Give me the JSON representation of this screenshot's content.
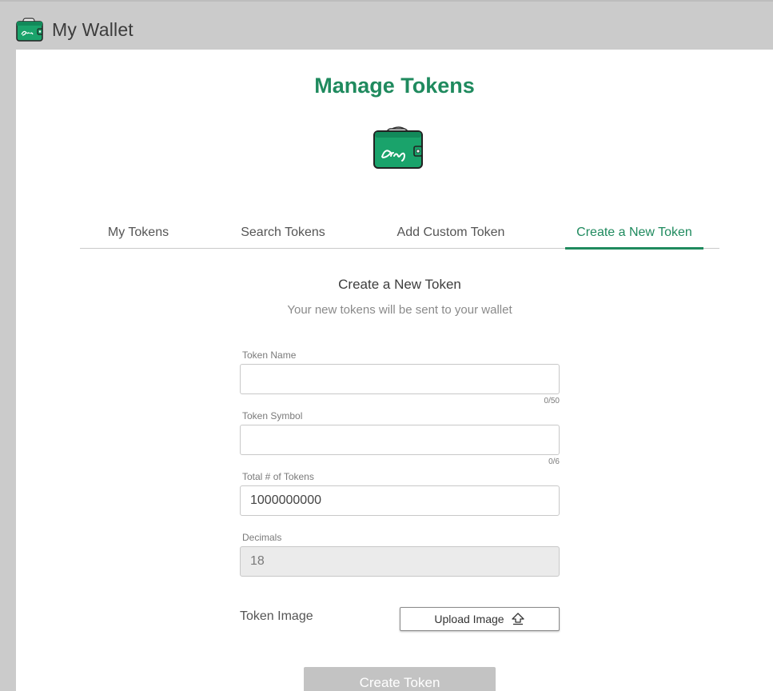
{
  "app": {
    "title": "My Wallet",
    "logo_icon": "wallet-logo-icon",
    "brand_color": "#1f8a5e"
  },
  "page": {
    "title": "Manage Tokens",
    "logo_icon": "wallet-logo-icon"
  },
  "tabs": [
    {
      "label": "My Tokens",
      "active": false
    },
    {
      "label": "Search Tokens",
      "active": false
    },
    {
      "label": "Add Custom Token",
      "active": false
    },
    {
      "label": "Create a New Token",
      "active": true
    }
  ],
  "form": {
    "title": "Create a New Token",
    "subtitle": "Your new tokens will be sent to your wallet",
    "token_name": {
      "label": "Token Name",
      "value": "",
      "counter": "0/50"
    },
    "token_symbol": {
      "label": "Token Symbol",
      "value": "",
      "counter": "0/6"
    },
    "total_tokens": {
      "label": "Total # of Tokens",
      "value": "1000000000"
    },
    "decimals": {
      "label": "Decimals",
      "value": "18"
    },
    "token_image": {
      "label": "Token Image",
      "upload_label": "Upload Image",
      "upload_icon": "upload-icon"
    },
    "submit_label": "Create Token"
  }
}
